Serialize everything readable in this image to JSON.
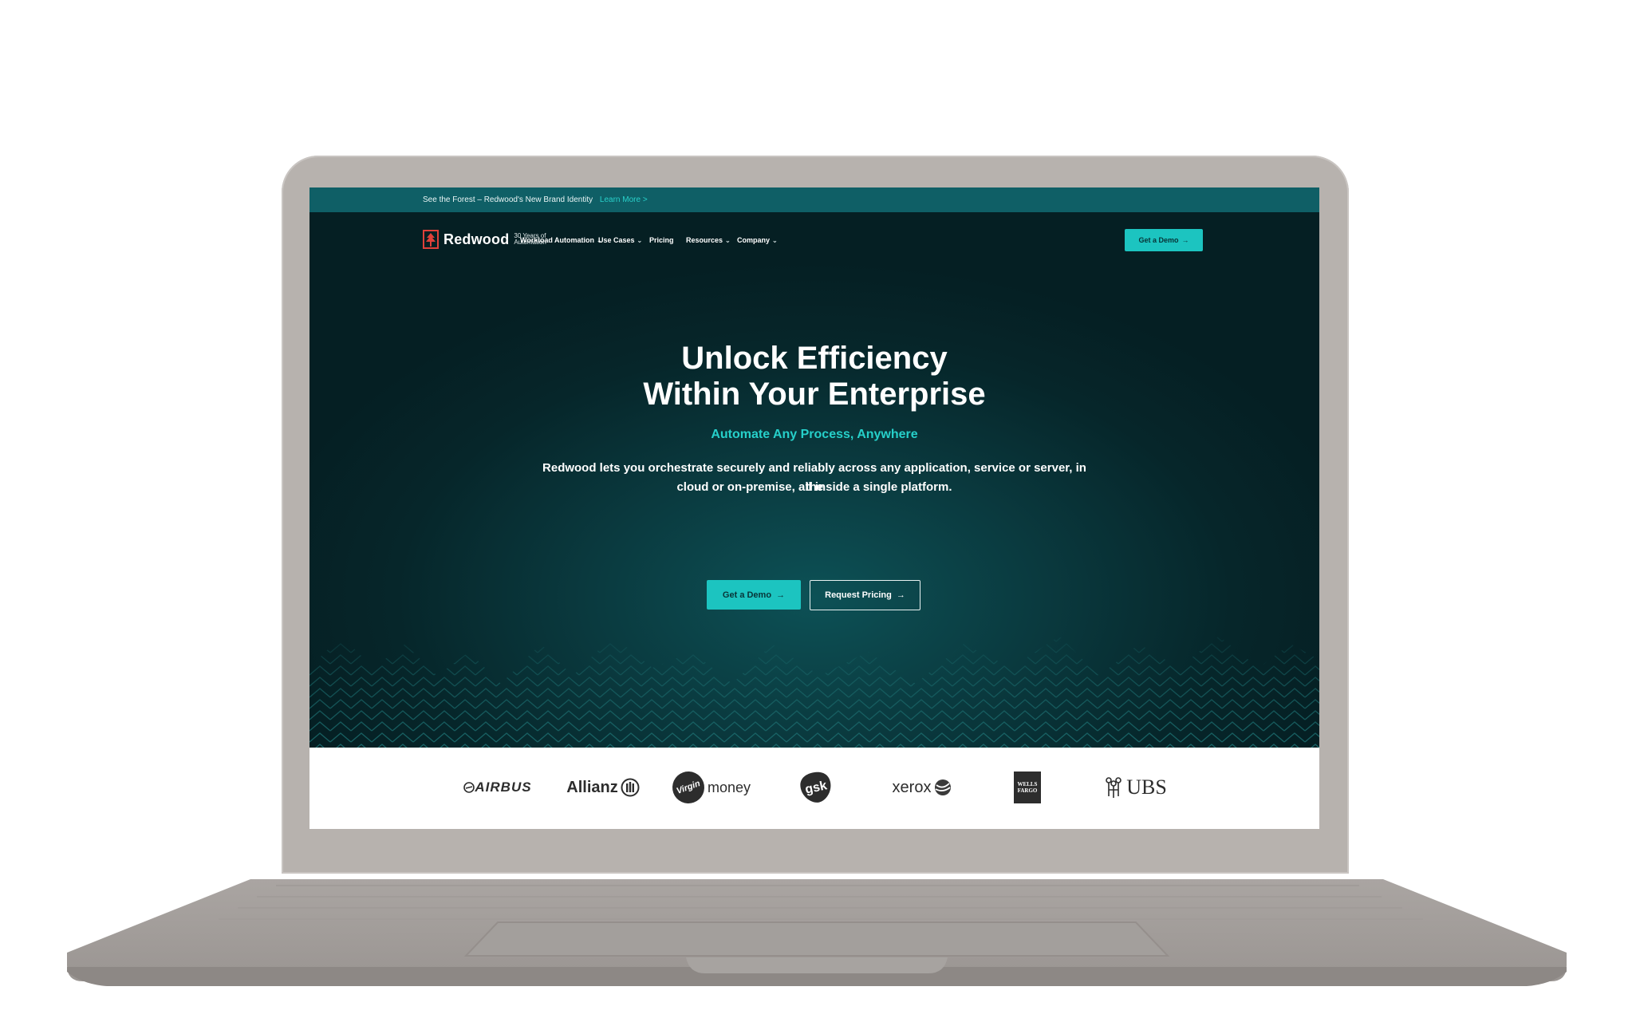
{
  "announcement": {
    "text": "See the Forest – Redwood's New Brand Identity",
    "link": "Learn More >"
  },
  "brand": {
    "name": "Redwood",
    "tagline": "30 Years of Automation"
  },
  "nav": {
    "items": [
      {
        "label": "Workload Automation",
        "chevron": "⌄"
      },
      {
        "label": "Use Cases",
        "chevron": "⌄"
      },
      {
        "label": "Pricing",
        "chevron": ""
      },
      {
        "label": "Resources",
        "chevron": "⌄"
      },
      {
        "label": "Company",
        "chevron": "⌄"
      }
    ],
    "cta": "Get a Demo"
  },
  "hero": {
    "title_line1": "Unlock Efficiency",
    "title_line2": "Within Your Enterprise",
    "subtitle": "Automate Any Process, Anywhere",
    "description_line1": "Redwood lets you orchestrate securely and reliably across any application, service or server, in the",
    "description_line2": "cloud or on-premise, all inside a single platform.",
    "primary_cta": "Get a Demo",
    "secondary_cta": "Request Pricing",
    "arrow": "→"
  },
  "customers": {
    "airbus": "AIRBUS",
    "allianz": "Allianz",
    "virgin": "Virgin",
    "money": "money",
    "gsk": "gsk",
    "xerox": "xerox",
    "wells_line1": "WELLS",
    "wells_line2": "FARGO",
    "ubs": "UBS"
  },
  "colors": {
    "accent": "#1cc4c0",
    "announcement_bg": "#0f5f66",
    "hero_dark": "#06262a",
    "laptop_body": "#b7b2ae",
    "redwood_red": "#e0413a"
  },
  "icons": [
    "redwood-tree-logo-icon",
    "chevron-down-icon",
    "arrow-right-icon",
    "allianz-icon",
    "xerox-globe-icon",
    "ubs-keys-icon"
  ]
}
